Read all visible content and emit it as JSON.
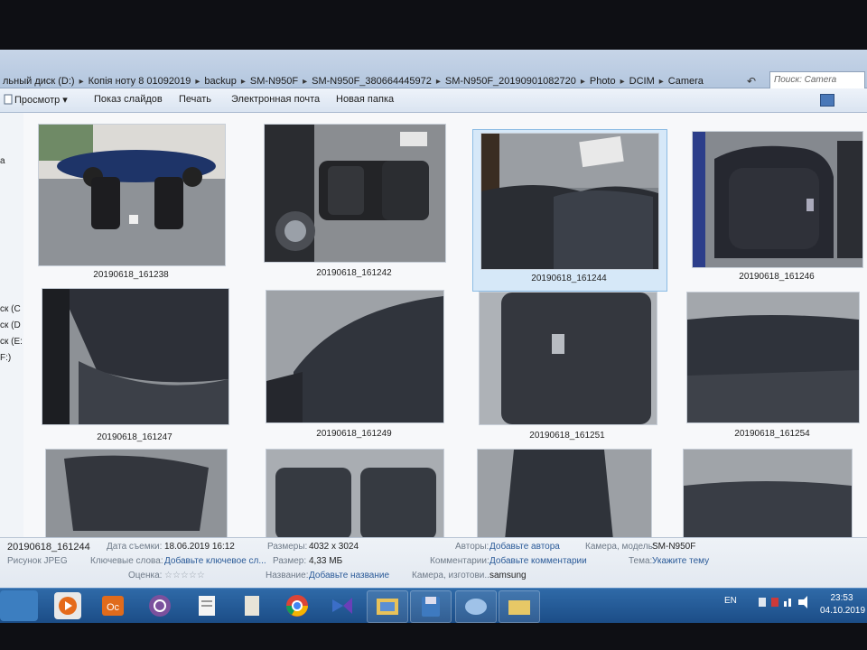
{
  "address": {
    "crumbs": [
      "льный диск (D:)",
      "Копія ноту 8 01092019",
      "backup",
      "SM-N950F",
      "SM-N950F_380664445972",
      "SM-N950F_20190901082720",
      "Photo",
      "DCIM",
      "Camera"
    ],
    "separator": "▸",
    "nav_symbol": "↶",
    "search_placeholder": "Поиск: Camera"
  },
  "toolbar": {
    "view_label": "Просмотр ▾",
    "slideshow_label": "Показ слайдов",
    "print_label": "Печать",
    "email_label": "Электронная почта",
    "new_folder_label": "Новая папка"
  },
  "left_pane": {
    "items": [
      "а",
      "ск (C",
      "ск (D",
      "ск (E:",
      "F:)"
    ]
  },
  "files": [
    {
      "name": "20190618_161238"
    },
    {
      "name": "20190618_161242"
    },
    {
      "name": "20190618_161244"
    },
    {
      "name": "20190618_161246"
    },
    {
      "name": "20190618_161247"
    },
    {
      "name": "20190618_161249"
    },
    {
      "name": "20190618_161251"
    },
    {
      "name": "20190618_161254"
    },
    {
      "name": ""
    },
    {
      "name": ""
    },
    {
      "name": ""
    },
    {
      "name": ""
    }
  ],
  "selected_index": 2,
  "details": {
    "file_name": "20190618_161244",
    "file_type": "Рисунок JPEG",
    "date_taken_label": "Дата съемки:",
    "date_taken": "18.06.2019 16:12",
    "keywords_label": "Ключевые слова:",
    "keywords": "Добавьте ключевое сл...",
    "rating_label": "Оценка:",
    "dimensions_label": "Размеры:",
    "dimensions": "4032 x 3024",
    "size_label": "Размер:",
    "size": "4,33 МБ",
    "title_label": "Название:",
    "title": "Добавьте название",
    "authors_label": "Авторы:",
    "authors": "Добавьте автора",
    "comments_label": "Комментарии:",
    "comments": "Добавьте комментарии",
    "maker_label": "Камера, изготови...",
    "maker": "samsung",
    "model_label": "Камера, модель:",
    "model": "SM-N950F",
    "subject_label": "Тема:",
    "subject": "Укажите тему"
  },
  "taskbar": {
    "language": "EN",
    "time": "23:53",
    "date": "04.10.2019"
  },
  "colors": {
    "accent": "#2a5a98",
    "taskbar": "#1b4c86",
    "selection": "#d6e8f8"
  }
}
